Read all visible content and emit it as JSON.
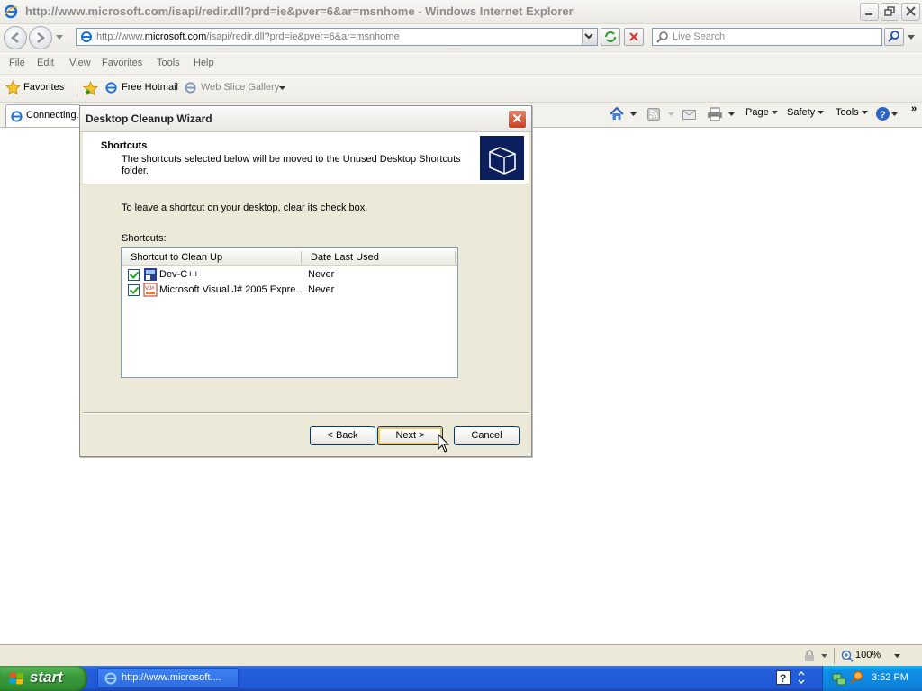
{
  "browser": {
    "window_title": "http://www.microsoft.com/isapi/redir.dll?prd=ie&pver=6&ar=msnhome - Windows Internet Explorer",
    "address": {
      "prefix": "http://www.",
      "domain": "microsoft.com",
      "path": "/isapi/redir.dll?prd=ie&pver=6&ar=msnhome"
    },
    "search_placeholder": "Live Search",
    "menu": [
      "File",
      "Edit",
      "View",
      "Favorites",
      "Tools",
      "Help"
    ],
    "favorites_bar": {
      "favorites_label": "Favorites",
      "free_hotmail": "Free Hotmail",
      "web_slice_gallery": "Web Slice Gallery"
    },
    "tab_label": "Connecting...",
    "command_bar": {
      "page": "Page",
      "safety": "Safety",
      "tools": "Tools"
    },
    "status": {
      "zoom": "100%"
    }
  },
  "dialog": {
    "title": "Desktop Cleanup Wizard",
    "header_title": "Shortcuts",
    "header_description": "The shortcuts selected below will be moved to the Unused Desktop Shortcuts folder.",
    "instruction": "To leave a shortcut on your desktop, clear its check box.",
    "shortcuts_label": "Shortcuts:",
    "columns": [
      "Shortcut to Clean Up",
      "Date Last Used"
    ],
    "rows": [
      {
        "name": "Dev-C++",
        "date": "Never",
        "checked": true
      },
      {
        "name": "Microsoft Visual J# 2005 Expre...",
        "date": "Never",
        "checked": true
      }
    ],
    "buttons": {
      "back": "< Back",
      "next": "Next >",
      "cancel": "Cancel"
    }
  },
  "taskbar": {
    "start_label": "start",
    "task_button": "http://www.microsoft....",
    "clock": "3:52 PM"
  },
  "colors": {
    "dialog_bg": "#ece9d8",
    "taskbar_blue": "#245edb",
    "start_green": "#3c9a3c",
    "close_red": "#c9401f"
  }
}
